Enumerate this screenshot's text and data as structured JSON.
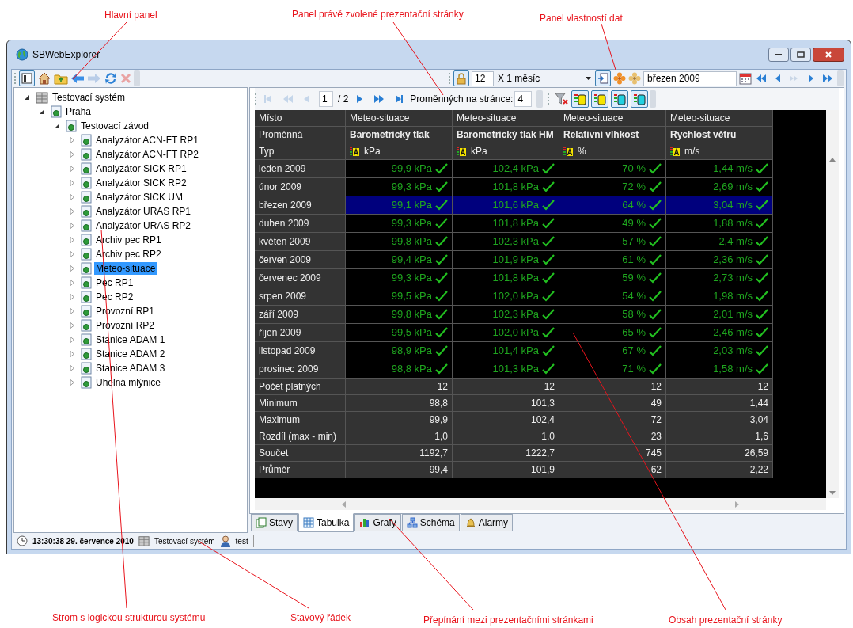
{
  "annotations": [
    {
      "text": "Hlavní panel"
    },
    {
      "text": "Panel právě zvolené prezentační stránky"
    },
    {
      "text": "Panel vlastností dat"
    },
    {
      "text": "Strom s logickou strukturou systému"
    },
    {
      "text": "Stavový řádek"
    },
    {
      "text": "Přepínání mezi prezentačními stránkami"
    },
    {
      "text": "Obsah prezentační stránky"
    }
  ],
  "window": {
    "title": "SBWebExplorer"
  },
  "main_toolbar": {
    "period_count": "12",
    "period_unit": "X 1 měsíc",
    "date": "březen 2009"
  },
  "tree": [
    {
      "label": "Testovací systém",
      "kind": "system",
      "expanded": true,
      "selected": false,
      "children": [
        {
          "label": "Praha",
          "kind": "node",
          "expanded": true,
          "selected": false,
          "children": [
            {
              "label": "Testovací závod",
              "kind": "node",
              "expanded": true,
              "selected": false,
              "children": [
                {
                  "label": "Analyzátor ACN-FT RP1",
                  "kind": "node",
                  "expanded": false,
                  "selected": false
                },
                {
                  "label": "Analyzátor ACN-FT RP2",
                  "kind": "node",
                  "expanded": false,
                  "selected": false
                },
                {
                  "label": "Analyzátor SICK RP1",
                  "kind": "node",
                  "expanded": false,
                  "selected": false
                },
                {
                  "label": "Analyzátor SICK RP2",
                  "kind": "node",
                  "expanded": false,
                  "selected": false
                },
                {
                  "label": "Analyzátor SICK UM",
                  "kind": "node",
                  "expanded": false,
                  "selected": false
                },
                {
                  "label": "Analyzátor URAS RP1",
                  "kind": "node",
                  "expanded": false,
                  "selected": false
                },
                {
                  "label": "Analyzátor URAS RP2",
                  "kind": "node",
                  "expanded": false,
                  "selected": false
                },
                {
                  "label": "Archiv pec RP1",
                  "kind": "node",
                  "expanded": false,
                  "selected": false
                },
                {
                  "label": "Archiv pec RP2",
                  "kind": "node",
                  "expanded": false,
                  "selected": false
                },
                {
                  "label": "Meteo-situace",
                  "kind": "node",
                  "expanded": false,
                  "selected": true
                },
                {
                  "label": "Pec RP1",
                  "kind": "node",
                  "expanded": false,
                  "selected": false
                },
                {
                  "label": "Pec RP2",
                  "kind": "node",
                  "expanded": false,
                  "selected": false
                },
                {
                  "label": "Provozní RP1",
                  "kind": "node",
                  "expanded": false,
                  "selected": false
                },
                {
                  "label": "Provozní RP2",
                  "kind": "node",
                  "expanded": false,
                  "selected": false
                },
                {
                  "label": "Stanice ADAM 1",
                  "kind": "node",
                  "expanded": false,
                  "selected": false
                },
                {
                  "label": "Stanice ADAM 2",
                  "kind": "node",
                  "expanded": false,
                  "selected": false
                },
                {
                  "label": "Stanice ADAM 3",
                  "kind": "node",
                  "expanded": false,
                  "selected": false
                },
                {
                  "label": "Uhelná mlýnice",
                  "kind": "node",
                  "expanded": false,
                  "selected": false
                }
              ]
            }
          ]
        }
      ]
    }
  ],
  "pager": {
    "page": "1",
    "total": "/ 2",
    "per_page_label": "Proměnných na stránce:",
    "per_page": "4"
  },
  "table": {
    "header_rows": [
      {
        "label": "Místo",
        "kind": "text",
        "cells": [
          "Meteo-situace",
          "Meteo-situace",
          "Meteo-situace",
          "Meteo-situace"
        ]
      },
      {
        "label": "Proměnná",
        "kind": "bold",
        "cells": [
          "Barometrický tlak",
          "Barometrický tlak HM",
          "Relativní vlhkost",
          "Rychlost větru"
        ]
      },
      {
        "label": "Typ",
        "kind": "type",
        "cells": [
          "kPa",
          "kPa",
          "%",
          "m/s"
        ]
      }
    ],
    "rows": [
      {
        "label": "leden 2009",
        "selected": false,
        "cells": [
          "99,9 kPa",
          "102,4 kPa",
          "70 %",
          "1,44 m/s"
        ]
      },
      {
        "label": "únor 2009",
        "selected": false,
        "cells": [
          "99,3 kPa",
          "101,8 kPa",
          "72 %",
          "2,69 m/s"
        ]
      },
      {
        "label": "březen 2009",
        "selected": true,
        "cells": [
          "99,1 kPa",
          "101,6 kPa",
          "64 %",
          "3,04 m/s"
        ]
      },
      {
        "label": "duben 2009",
        "selected": false,
        "cells": [
          "99,3 kPa",
          "101,8 kPa",
          "49 %",
          "1,88 m/s"
        ]
      },
      {
        "label": "květen 2009",
        "selected": false,
        "cells": [
          "99,8 kPa",
          "102,3 kPa",
          "57 %",
          "2,4 m/s"
        ]
      },
      {
        "label": "červen 2009",
        "selected": false,
        "cells": [
          "99,4 kPa",
          "101,9 kPa",
          "61 %",
          "2,36 m/s"
        ]
      },
      {
        "label": "červenec 2009",
        "selected": false,
        "cells": [
          "99,3 kPa",
          "101,8 kPa",
          "59 %",
          "2,73 m/s"
        ]
      },
      {
        "label": "srpen 2009",
        "selected": false,
        "cells": [
          "99,5 kPa",
          "102,0 kPa",
          "54 %",
          "1,98 m/s"
        ]
      },
      {
        "label": "září 2009",
        "selected": false,
        "cells": [
          "99,8 kPa",
          "102,3 kPa",
          "58 %",
          "2,01 m/s"
        ]
      },
      {
        "label": "říjen 2009",
        "selected": false,
        "cells": [
          "99,5 kPa",
          "102,0 kPa",
          "65 %",
          "2,46 m/s"
        ]
      },
      {
        "label": "listopad 2009",
        "selected": false,
        "cells": [
          "98,9 kPa",
          "101,4 kPa",
          "67 %",
          "2,03 m/s"
        ]
      },
      {
        "label": "prosinec 2009",
        "selected": false,
        "cells": [
          "98,8 kPa",
          "101,3 kPa",
          "71 %",
          "1,58 m/s"
        ]
      }
    ],
    "summary_rows": [
      {
        "label": "Počet platných",
        "cells": [
          "12",
          "12",
          "12",
          "12"
        ]
      },
      {
        "label": "Minimum",
        "cells": [
          "98,8",
          "101,3",
          "49",
          "1,44"
        ]
      },
      {
        "label": "Maximum",
        "cells": [
          "99,9",
          "102,4",
          "72",
          "3,04"
        ]
      },
      {
        "label": "Rozdíl (max - min)",
        "cells": [
          "1,0",
          "1,0",
          "23",
          "1,6"
        ]
      },
      {
        "label": "Součet",
        "cells": [
          "1192,7",
          "1222,7",
          "745",
          "26,59"
        ]
      },
      {
        "label": "Průměr",
        "cells": [
          "99,4",
          "101,9",
          "62",
          "2,22"
        ]
      }
    ]
  },
  "tabs": [
    {
      "label": "Stavy",
      "selected": false
    },
    {
      "label": "Tabulka",
      "selected": true
    },
    {
      "label": "Grafy",
      "selected": false
    },
    {
      "label": "Schéma",
      "selected": false
    },
    {
      "label": "Alarmy",
      "selected": false
    }
  ],
  "status_bar": {
    "time": "13:30:38 29. července 2010",
    "system": "Testovací systém",
    "user": "test"
  }
}
